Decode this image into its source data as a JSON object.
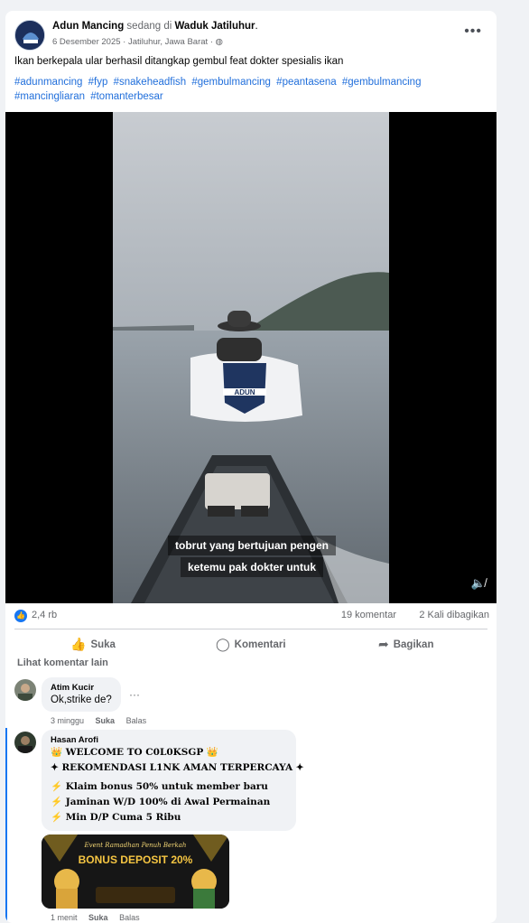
{
  "post": {
    "author": "Adun Mancing",
    "at_text": "sedang di",
    "location": "Waduk Jatiluhur",
    "date": "6 Desember 2025",
    "place": "Jatiluhur, Jawa Barat",
    "caption": "Ikan berkepala ular berhasil ditangkap gembul feat dokter spesialis ikan",
    "hashtags": [
      "#adunmancing",
      "#fyp",
      "#snakeheadfish",
      "#gembulmancing",
      "#peantasena",
      "#gembulmancing",
      "#mancingliaran",
      "#tomanterbesar"
    ]
  },
  "video": {
    "subtitle_line1": "tobrut yang bertujuan pengen",
    "subtitle_line2": "ketemu pak dokter untuk",
    "flag_text": "ADUN"
  },
  "stats": {
    "likes": "2,4 rb",
    "comments": "19 komentar",
    "shares": "2 Kali dibagikan"
  },
  "actions": {
    "like": "Suka",
    "comment": "Komentari",
    "share": "Bagikan"
  },
  "comments_section": {
    "more_label": "Lihat komentar lain",
    "comments": [
      {
        "name": "Atim Kucir",
        "text": "Ok,strike de?",
        "time": "3 minggu",
        "like": "Suka",
        "reply": "Balas"
      },
      {
        "name": "Hasan Arofi",
        "lines": [
          "👑 WELCOME TO C0L0KSGP 👑",
          "✦ REKOMENDASI L1NK AMAN TERPERCAYA ✦",
          "⚡ Klaim bonus 50% untuk member baru",
          "⚡ Jaminan W/D 100% di Awal Permainan",
          "⚡ Min D/P Cuma 5 Ribu"
        ],
        "banner_top": "Event Ramadhan Penuh Berkah",
        "banner_main": "BONUS DEPOSIT 20%",
        "time": "1 menit",
        "like": "Suka",
        "reply": "Balas"
      }
    ]
  },
  "colors": {
    "link": "#216fdb",
    "accent": "#1877f2",
    "muted": "#65676b"
  }
}
